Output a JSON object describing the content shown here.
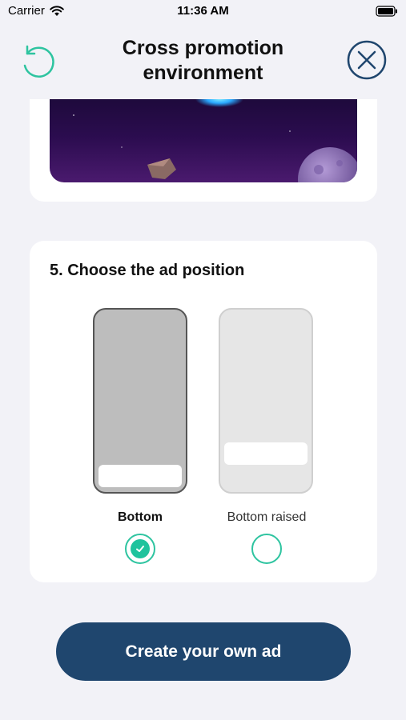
{
  "status_bar": {
    "carrier": "Carrier",
    "time": "11:36 AM",
    "wifi_icon": "wifi-icon",
    "battery_icon": "battery-icon"
  },
  "header": {
    "title_line1": "Cross promotion",
    "title_line2": "environment",
    "refresh_icon": "refresh-icon",
    "close_icon": "close-circle-icon"
  },
  "position_section": {
    "title": "5. Choose the ad position",
    "options": [
      {
        "label": "Bottom",
        "selected": true
      },
      {
        "label": "Bottom raised",
        "selected": false
      }
    ]
  },
  "cta": {
    "label": "Create your own ad"
  },
  "colors": {
    "accent_green": "#1fc39d",
    "cta_blue": "#1f466e",
    "background": "#f2f2f7",
    "scene_purple": "#2b0c4f"
  }
}
